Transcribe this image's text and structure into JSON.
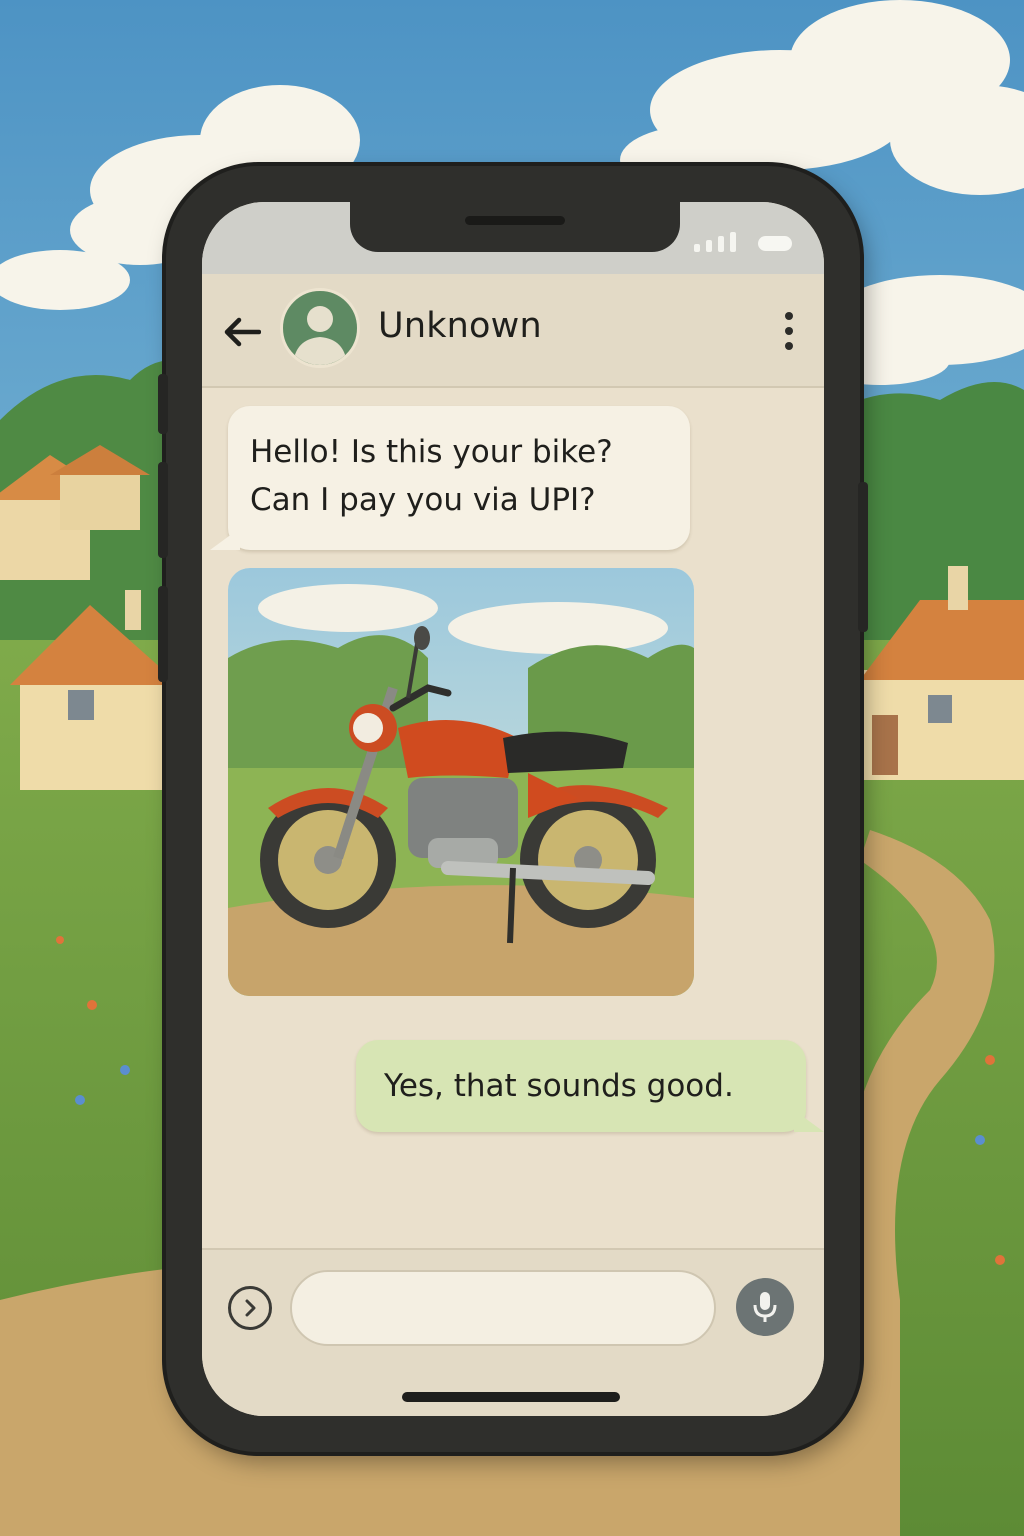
{
  "status_bar": {
    "signal_icon": "signal-bars-icon",
    "battery_icon": "battery-icon"
  },
  "header": {
    "back_icon": "arrow-left-icon",
    "contact_name": "Unknown",
    "avatar_icon": "default-user-avatar-icon",
    "menu_icon": "more-vertical-icon"
  },
  "messages": [
    {
      "direction": "incoming",
      "type": "text",
      "lines": [
        "Hello! Is this your bike?",
        "Can I pay you via UPI?"
      ]
    },
    {
      "direction": "incoming",
      "type": "image",
      "image_subject": "red motorcycle"
    },
    {
      "direction": "outgoing",
      "type": "text",
      "text": "Yes, that sounds good."
    }
  ],
  "composer": {
    "attach_icon": "chevron-right-circle-icon",
    "input_value": "",
    "input_placeholder": "",
    "mic_icon": "microphone-icon"
  },
  "colors": {
    "incoming_bubble": "#f6f1e4",
    "outgoing_bubble": "#d7e5b4",
    "chat_background": "#eae0cc",
    "header_background": "#e3dac6",
    "phone_frame": "#2f2f2c",
    "mic_button": "#6c7474",
    "avatar": "#5e8a63"
  }
}
